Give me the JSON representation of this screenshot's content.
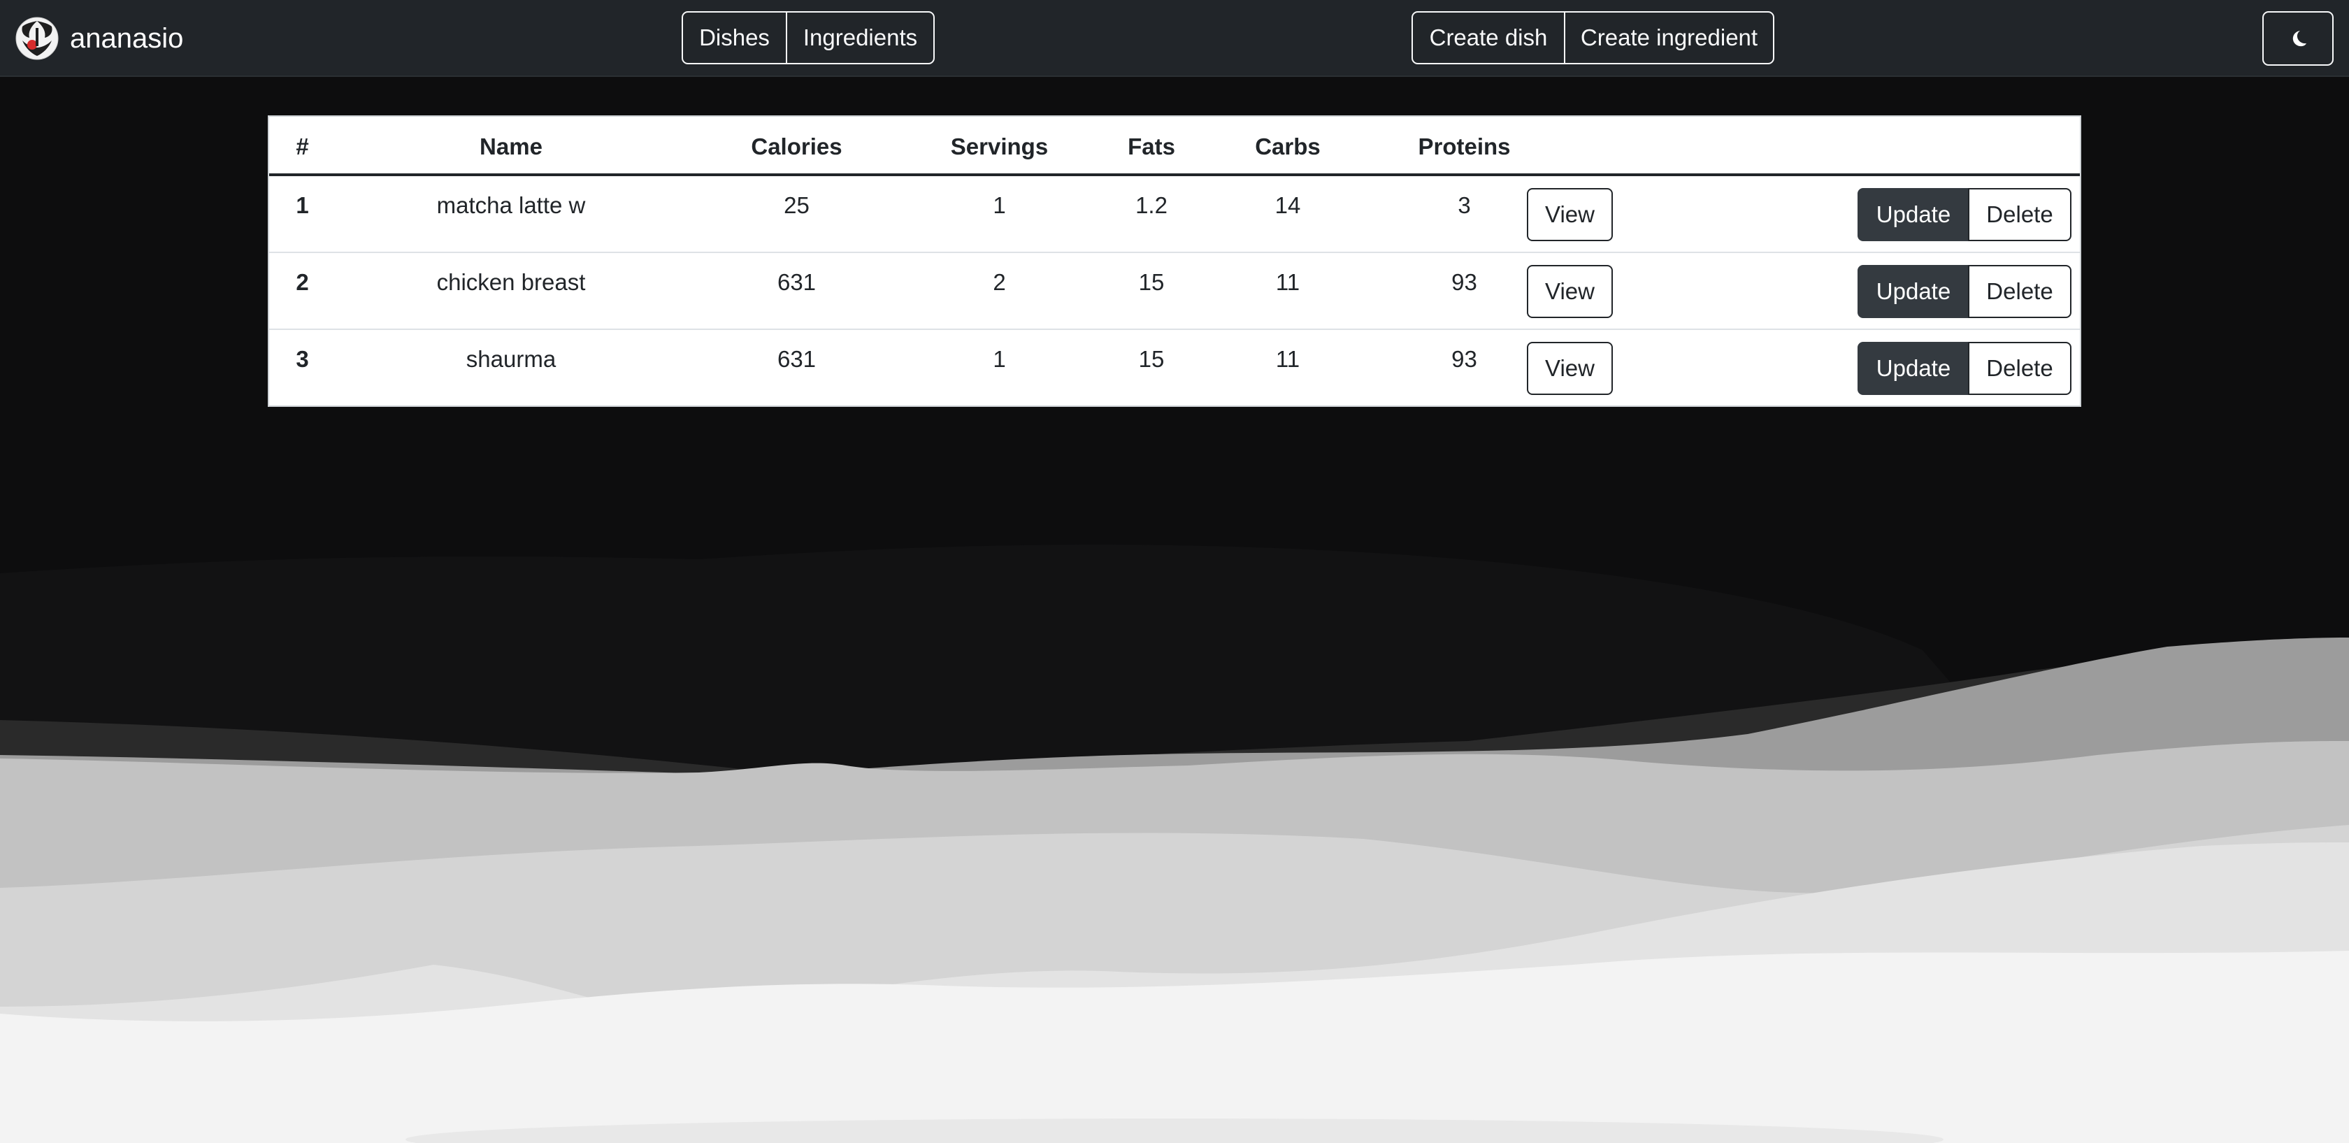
{
  "brand": {
    "name": "ananasio"
  },
  "nav": {
    "dishes": "Dishes",
    "ingredients": "Ingredients"
  },
  "create": {
    "dish": "Create dish",
    "ingredient": "Create ingredient"
  },
  "theme_toggle": {
    "icon": "moon-icon"
  },
  "table": {
    "headers": [
      "#",
      "Name",
      "Calories",
      "Servings",
      "Fats",
      "Carbs",
      "Proteins"
    ],
    "rows": [
      {
        "num": "1",
        "name": "matcha latte w",
        "calories": "25",
        "servings": "1",
        "fats": "1.2",
        "carbs": "14",
        "proteins": "3"
      },
      {
        "num": "2",
        "name": "chicken breast",
        "calories": "631",
        "servings": "2",
        "fats": "15",
        "carbs": "11",
        "proteins": "93"
      },
      {
        "num": "3",
        "name": "shaurma",
        "calories": "631",
        "servings": "1",
        "fats": "15",
        "carbs": "11",
        "proteins": "93"
      }
    ],
    "actions": {
      "view": "View",
      "update": "Update",
      "delete": "Delete"
    }
  },
  "colors": {
    "navbar": "#212529",
    "page_bg": "#0d0d0e",
    "update_button": "#343a40",
    "text": "#212529"
  }
}
